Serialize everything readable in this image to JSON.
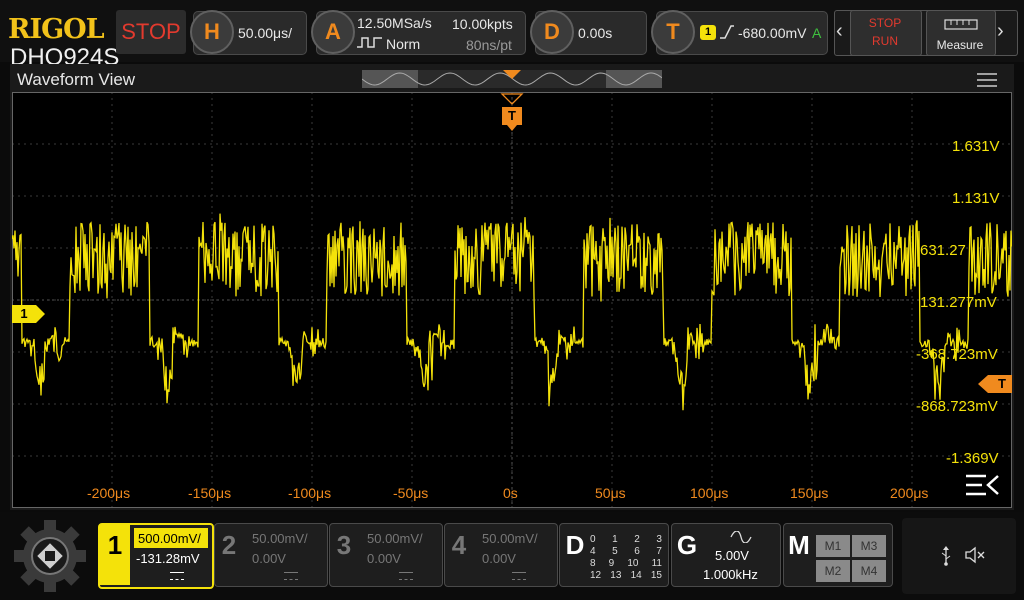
{
  "brand": "RIGOL",
  "model": "DHO924S",
  "run_state": "STOP",
  "horizontal": {
    "key": "H",
    "timebase": "50.00μs/"
  },
  "acquire": {
    "key": "A",
    "sample_rate": "12.50MSa/s",
    "points": "10.00kpts",
    "mode": "Norm",
    "resolution": "80ns/pt"
  },
  "delay": {
    "key": "D",
    "value": "0.00s"
  },
  "trigger": {
    "key": "T",
    "channel": "1",
    "level": "-680.00mV",
    "mode": "A"
  },
  "stop_run": {
    "stop": "STOP",
    "run": "RUN"
  },
  "measure_label": "Measure",
  "view_title": "Waveform View",
  "trigger_marker": "T",
  "channel_marker": "1",
  "trigger_level_marker": "T",
  "voltage_labels": [
    "1.631V",
    "1.131V",
    "631.27",
    "131.277mV",
    "-368.723mV",
    "-868.723mV",
    "-1.369V"
  ],
  "time_labels": [
    "-200μs",
    "-150μs",
    "-100μs",
    "-50μs",
    "0s",
    "50μs",
    "100μs",
    "150μs",
    "200μs"
  ],
  "channels": [
    {
      "num": "1",
      "scale": "500.00mV/",
      "offset": "-131.28mV",
      "active": true
    },
    {
      "num": "2",
      "scale": "50.00mV/",
      "offset": "0.00V",
      "active": false
    },
    {
      "num": "3",
      "scale": "50.00mV/",
      "offset": "0.00V",
      "active": false
    },
    {
      "num": "4",
      "scale": "50.00mV/",
      "offset": "0.00V",
      "active": false
    }
  ],
  "digital": {
    "key": "D",
    "rows": [
      [
        "0",
        "1",
        "2",
        "3"
      ],
      [
        "4",
        "5",
        "6",
        "7"
      ],
      [
        "8",
        "9",
        "10",
        "11"
      ],
      [
        "12",
        "13",
        "14",
        "15"
      ]
    ]
  },
  "generator": {
    "key": "G",
    "amplitude": "5.00V",
    "frequency": "1.000kHz"
  },
  "math": {
    "key": "M",
    "items": [
      "M1",
      "M3",
      "M2",
      "M4"
    ]
  },
  "colors": {
    "ch1": "#f4e20a",
    "accent": "#f08a1e",
    "stop": "#e23a2e",
    "brand": "#f2c21a"
  }
}
